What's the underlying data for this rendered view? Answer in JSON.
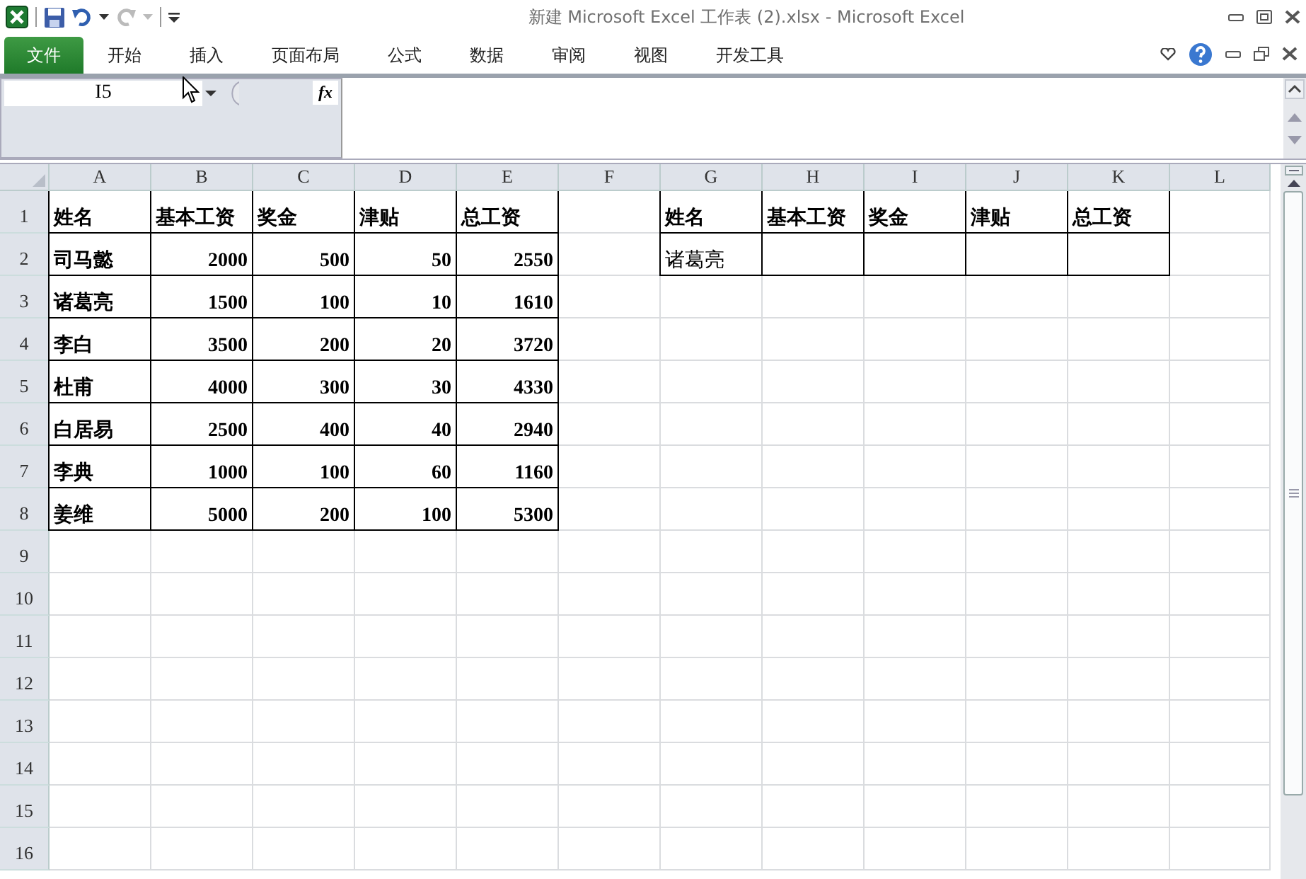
{
  "window": {
    "title": "新建 Microsoft Excel 工作表 (2).xlsx  -  Microsoft Excel"
  },
  "ribbon_tabs": [
    {
      "label": "文件",
      "selected": true
    },
    {
      "label": "开始",
      "selected": false
    },
    {
      "label": "插入",
      "selected": false
    },
    {
      "label": "页面布局",
      "selected": false
    },
    {
      "label": "公式",
      "selected": false
    },
    {
      "label": "数据",
      "selected": false
    },
    {
      "label": "审阅",
      "selected": false
    },
    {
      "label": "视图",
      "selected": false
    },
    {
      "label": "开发工具",
      "selected": false
    }
  ],
  "formula_bar": {
    "name_box": "I5",
    "fx": "fx"
  },
  "sheet": {
    "columns": [
      "A",
      "B",
      "C",
      "D",
      "E",
      "F",
      "G",
      "H",
      "I",
      "J",
      "K",
      "L"
    ],
    "rows": [
      {
        "label": "1",
        "cells": [
          {
            "text": "姓名",
            "kind": "text",
            "bold": true,
            "bordered": true
          },
          {
            "text": "基本工资",
            "kind": "text",
            "bold": true,
            "bordered": true
          },
          {
            "text": "奖金",
            "kind": "text",
            "bold": true,
            "bordered": true
          },
          {
            "text": "津贴",
            "kind": "text",
            "bold": true,
            "bordered": true
          },
          {
            "text": "总工资",
            "kind": "text",
            "bold": true,
            "bordered": true
          },
          {
            "bordered": false
          },
          {
            "text": "姓名",
            "kind": "text",
            "bold": true,
            "bordered": true
          },
          {
            "text": "基本工资",
            "kind": "text",
            "bold": true,
            "bordered": true
          },
          {
            "text": "奖金",
            "kind": "text",
            "bold": true,
            "bordered": true
          },
          {
            "text": "津贴",
            "kind": "text",
            "bold": true,
            "bordered": true
          },
          {
            "text": "总工资",
            "kind": "text",
            "bold": true,
            "bordered": true
          },
          {
            "bordered": false
          }
        ]
      },
      {
        "label": "2",
        "cells": [
          {
            "text": "司马懿",
            "kind": "text",
            "bold": true,
            "bordered": true
          },
          {
            "text": "2000",
            "kind": "number",
            "bold": true,
            "bordered": true
          },
          {
            "text": "500",
            "kind": "number",
            "bold": true,
            "bordered": true
          },
          {
            "text": "50",
            "kind": "number",
            "bold": true,
            "bordered": true
          },
          {
            "text": "2550",
            "kind": "number",
            "bold": true,
            "bordered": true
          },
          {
            "bordered": false
          },
          {
            "text": "诸葛亮",
            "kind": "text",
            "bold": false,
            "bordered": true
          },
          {
            "bordered": true
          },
          {
            "bordered": true
          },
          {
            "bordered": true
          },
          {
            "bordered": true
          },
          {
            "bordered": false
          }
        ]
      },
      {
        "label": "3",
        "cells": [
          {
            "text": "诸葛亮",
            "kind": "text",
            "bold": true,
            "bordered": true
          },
          {
            "text": "1500",
            "kind": "number",
            "bold": true,
            "bordered": true
          },
          {
            "text": "100",
            "kind": "number",
            "bold": true,
            "bordered": true
          },
          {
            "text": "10",
            "kind": "number",
            "bold": true,
            "bordered": true
          },
          {
            "text": "1610",
            "kind": "number",
            "bold": true,
            "bordered": true
          },
          {
            "bordered": false
          },
          {
            "bordered": false
          },
          {
            "bordered": false
          },
          {
            "bordered": false
          },
          {
            "bordered": false
          },
          {
            "bordered": false
          },
          {
            "bordered": false
          }
        ]
      },
      {
        "label": "4",
        "cells": [
          {
            "text": "李白",
            "kind": "text",
            "bold": true,
            "bordered": true
          },
          {
            "text": "3500",
            "kind": "number",
            "bold": true,
            "bordered": true
          },
          {
            "text": "200",
            "kind": "number",
            "bold": true,
            "bordered": true
          },
          {
            "text": "20",
            "kind": "number",
            "bold": true,
            "bordered": true
          },
          {
            "text": "3720",
            "kind": "number",
            "bold": true,
            "bordered": true
          },
          {
            "bordered": false
          },
          {
            "bordered": false
          },
          {
            "bordered": false
          },
          {
            "bordered": false
          },
          {
            "bordered": false
          },
          {
            "bordered": false
          },
          {
            "bordered": false
          }
        ]
      },
      {
        "label": "5",
        "cells": [
          {
            "text": "杜甫",
            "kind": "text",
            "bold": true,
            "bordered": true
          },
          {
            "text": "4000",
            "kind": "number",
            "bold": true,
            "bordered": true
          },
          {
            "text": "300",
            "kind": "number",
            "bold": true,
            "bordered": true
          },
          {
            "text": "30",
            "kind": "number",
            "bold": true,
            "bordered": true
          },
          {
            "text": "4330",
            "kind": "number",
            "bold": true,
            "bordered": true
          },
          {
            "bordered": false
          },
          {
            "bordered": false
          },
          {
            "bordered": false
          },
          {
            "bordered": false
          },
          {
            "bordered": false
          },
          {
            "bordered": false
          },
          {
            "bordered": false
          }
        ]
      },
      {
        "label": "6",
        "cells": [
          {
            "text": "白居易",
            "kind": "text",
            "bold": true,
            "bordered": true
          },
          {
            "text": "2500",
            "kind": "number",
            "bold": true,
            "bordered": true
          },
          {
            "text": "400",
            "kind": "number",
            "bold": true,
            "bordered": true
          },
          {
            "text": "40",
            "kind": "number",
            "bold": true,
            "bordered": true
          },
          {
            "text": "2940",
            "kind": "number",
            "bold": true,
            "bordered": true
          },
          {
            "bordered": false
          },
          {
            "bordered": false
          },
          {
            "bordered": false
          },
          {
            "bordered": false
          },
          {
            "bordered": false
          },
          {
            "bordered": false
          },
          {
            "bordered": false
          }
        ]
      },
      {
        "label": "7",
        "cells": [
          {
            "text": "李典",
            "kind": "text",
            "bold": true,
            "bordered": true
          },
          {
            "text": "1000",
            "kind": "number",
            "bold": true,
            "bordered": true
          },
          {
            "text": "100",
            "kind": "number",
            "bold": true,
            "bordered": true
          },
          {
            "text": "60",
            "kind": "number",
            "bold": true,
            "bordered": true
          },
          {
            "text": "1160",
            "kind": "number",
            "bold": true,
            "bordered": true
          },
          {
            "bordered": false
          },
          {
            "bordered": false
          },
          {
            "bordered": false
          },
          {
            "bordered": false
          },
          {
            "bordered": false
          },
          {
            "bordered": false
          },
          {
            "bordered": false
          }
        ]
      },
      {
        "label": "8",
        "cells": [
          {
            "text": "姜维",
            "kind": "text",
            "bold": true,
            "bordered": true
          },
          {
            "text": "5000",
            "kind": "number",
            "bold": true,
            "bordered": true
          },
          {
            "text": "200",
            "kind": "number",
            "bold": true,
            "bordered": true
          },
          {
            "text": "100",
            "kind": "number",
            "bold": true,
            "bordered": true
          },
          {
            "text": "5300",
            "kind": "number",
            "bold": true,
            "bordered": true
          },
          {
            "bordered": false
          },
          {
            "bordered": false
          },
          {
            "bordered": false
          },
          {
            "bordered": false
          },
          {
            "bordered": false
          },
          {
            "bordered": false
          },
          {
            "bordered": false
          }
        ]
      },
      {
        "label": "9"
      },
      {
        "label": "10"
      },
      {
        "label": "11"
      },
      {
        "label": "12"
      },
      {
        "label": "13"
      },
      {
        "label": "14"
      },
      {
        "label": "15"
      },
      {
        "label": "16"
      }
    ]
  }
}
